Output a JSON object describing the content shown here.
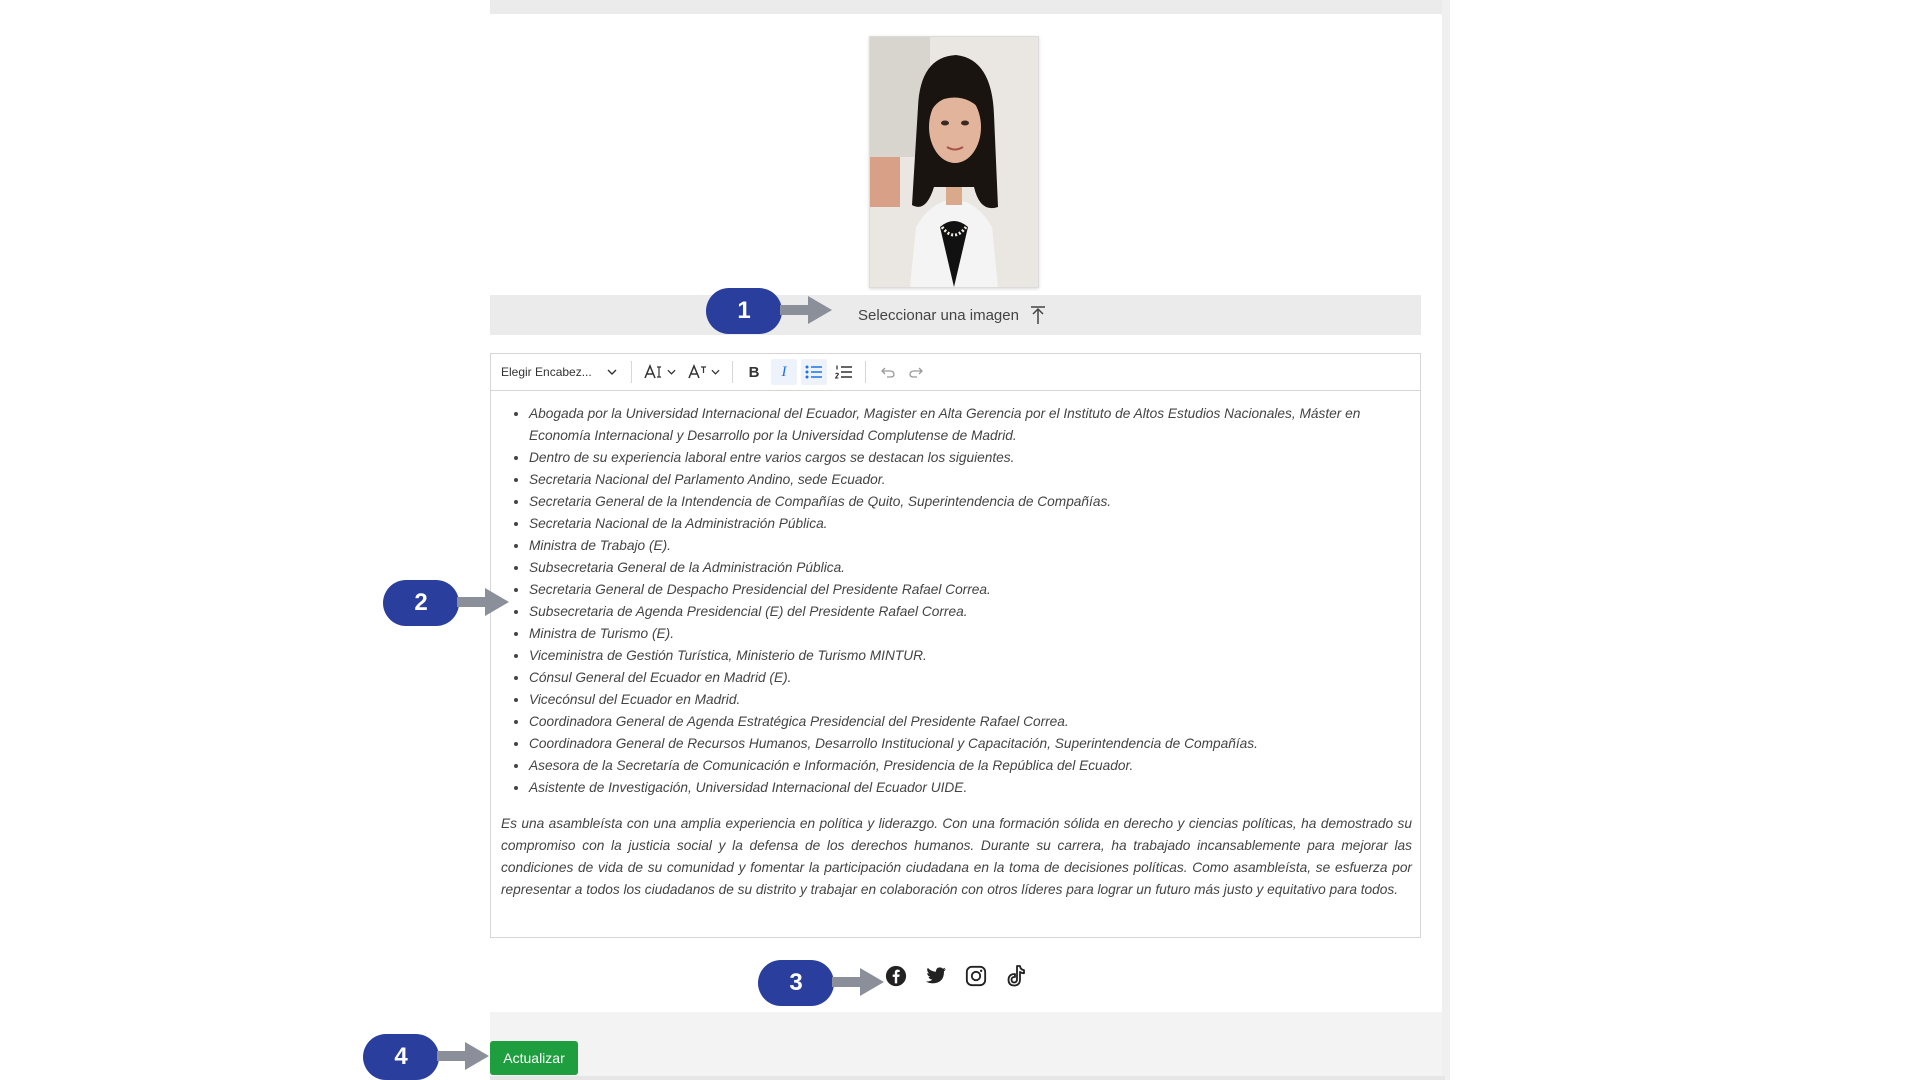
{
  "profile": {
    "upload_label": "Seleccionar una imagen"
  },
  "toolbar": {
    "heading_select": "Elegir Encabez...",
    "font_size_icon": "font-size-icon",
    "font_family_icon": "font-family-icon",
    "bold_label": "B",
    "italic_label": "I"
  },
  "bio": {
    "items": [
      "Abogada por la Universidad Internacional del Ecuador, Magister en Alta Gerencia por el Instituto de Altos Estudios Nacionales, Máster en Economía Internacional y Desarrollo por la Universidad Complutense de Madrid.",
      "Dentro de su experiencia laboral entre varios cargos se destacan los siguientes.",
      "Secretaria Nacional del Parlamento Andino, sede Ecuador.",
      "Secretaria General de la Intendencia de Compañías de Quito, Superintendencia de Compañías.",
      "Secretaria Nacional de la Administración Pública.",
      "Ministra de Trabajo (E).",
      "Subsecretaria General de la Administración Pública.",
      "Secretaria General de Despacho Presidencial del Presidente Rafael Correa.",
      "Subsecretaria de Agenda Presidencial (E) del Presidente Rafael Correa.",
      "Ministra de Turismo (E).",
      "Viceministra de Gestión Turística, Ministerio de Turismo MINTUR.",
      "Cónsul General del Ecuador en Madrid (E).",
      "Vicecónsul del Ecuador en Madrid.",
      "Coordinadora General de Agenda Estratégica Presidencial del Presidente Rafael Correa.",
      "Coordinadora General de Recursos Humanos, Desarrollo Institucional y Capacitación, Superintendencia de Compañías.",
      "Asesora de la Secretaría de Comunicación e Información, Presidencia de la República del Ecuador.",
      "Asistente de Investigación, Universidad Internacional del Ecuador UIDE."
    ],
    "paragraph": "Es una asambleísta con una amplia experiencia en política y liderazgo. Con una formación sólida en derecho y ciencias políticas, ha demostrado su compromiso con la justicia social y la defensa de los derechos humanos. Durante su carrera, ha trabajado incansablemente para mejorar las condiciones de vida de su comunidad y fomentar la participación ciudadana en la toma de decisiones políticas. Como asambleísta, se esfuerza por representar a todos los ciudadanos de su distrito y trabajar en colaboración con otros líderes para lograr un futuro más justo y equitativo para todos."
  },
  "socials": [
    "facebook-icon",
    "twitter-icon",
    "instagram-icon",
    "tiktok-icon"
  ],
  "actions": {
    "update_label": "Actualizar"
  },
  "callouts": [
    "1",
    "2",
    "3",
    "4"
  ],
  "colors": {
    "callout": "#2a3e9e",
    "update_button": "#1e9e3e",
    "active_tool": "#1a73e8"
  }
}
